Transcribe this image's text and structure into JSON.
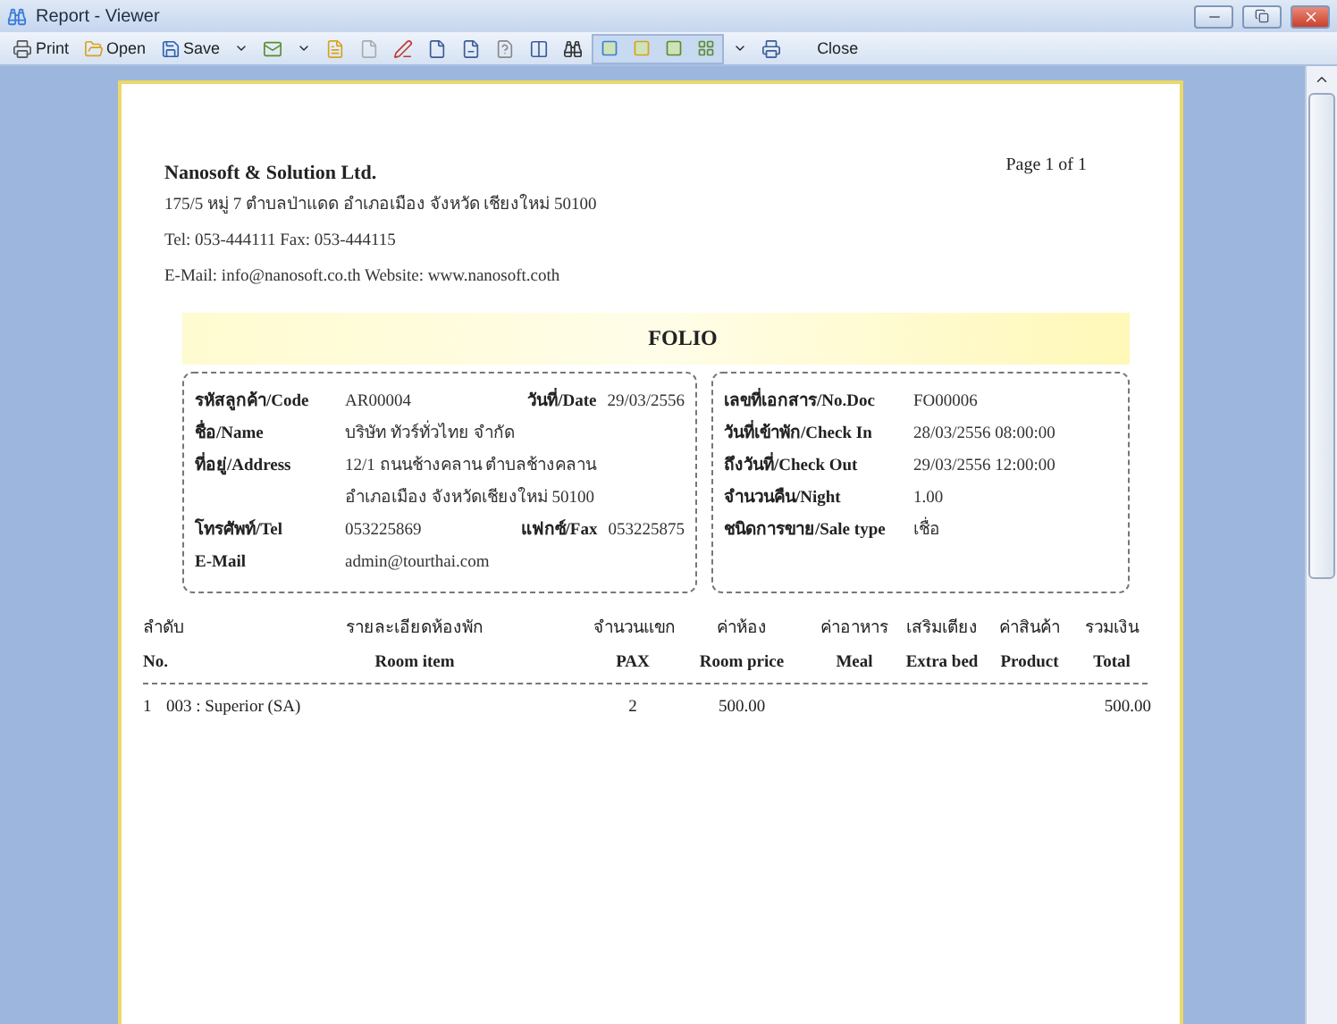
{
  "window": {
    "title": "Report - Viewer"
  },
  "toolbar": {
    "buttons": [
      {
        "label": "Print"
      },
      {
        "label": "Open"
      },
      {
        "label": "Save"
      }
    ],
    "close": "Close"
  },
  "report": {
    "company": {
      "name": "Nanosoft & Solution Ltd.",
      "address": "175/5 หมู่ 7 ตำบลป่าแดด อำเภอเมือง จังหวัด เชียงใหม่ 50100",
      "phone": "Tel: 053-444111  Fax: 053-444115",
      "contact": "E-Mail: info@nanosoft.co.th  Website: www.nanosoft.coth"
    },
    "page": "Page 1 of 1",
    "title": "FOLIO",
    "customer": [
      {
        "label": "รหัสลูกค้า/Code",
        "value": "AR00004",
        "label_2": "วันที่/Date",
        "value_2": "29/03/2556"
      },
      {
        "label": "ชื่อ/Name",
        "value": "บริษัท ทัวร์ทั่วไทย จำกัด"
      },
      {
        "label": "ที่อยู่/Address",
        "value": "12/1 ถนนช้างคลาน ตำบลช้างคลาน"
      },
      {
        "value": "อำเภอเมือง จังหวัดเชียงใหม่ 50100"
      },
      {
        "label": "โทรศัพท์/Tel",
        "value": "053225869",
        "label_2": "แฟกซ์/Fax",
        "value_2": "053225875"
      },
      {
        "label": "E-Mail",
        "value": "admin@tourthai.com"
      }
    ],
    "document": [
      {
        "label": "เลขที่เอกสาร/No.Doc",
        "value": "FO00006"
      },
      {
        "label": "วันที่เข้าพัก/Check In",
        "value": "28/03/2556 08:00:00"
      },
      {
        "label": "ถึงวันที่/Check Out",
        "value": "29/03/2556 12:00:00"
      },
      {
        "label": "จำนวนคืน/Night",
        "value": "1.00"
      },
      {
        "label": "ชนิดการขาย/Sale type",
        "value": "เชื่อ"
      }
    ],
    "columns": [
      {
        "thai": "ลำดับ",
        "english": "No."
      },
      {
        "thai": "รายละเอียดห้องพัก",
        "english": "Room item"
      },
      {
        "thai": "จำนวนแขก",
        "english": "PAX"
      },
      {
        "thai": "ค่าห้อง",
        "english": "Room price"
      },
      {
        "thai": "ค่าอาหาร",
        "english": "Meal"
      },
      {
        "thai": "เสริมเตียง",
        "english": "Extra bed"
      },
      {
        "thai": "ค่าสินค้า",
        "english": "Product"
      },
      {
        "thai": "รวมเงิน",
        "english": "Total"
      }
    ],
    "rows": [
      {
        "cells": [
          "1",
          "003 : Superior (SA)",
          "2",
          "500.00",
          null,
          null,
          null,
          "500.00"
        ]
      }
    ]
  }
}
